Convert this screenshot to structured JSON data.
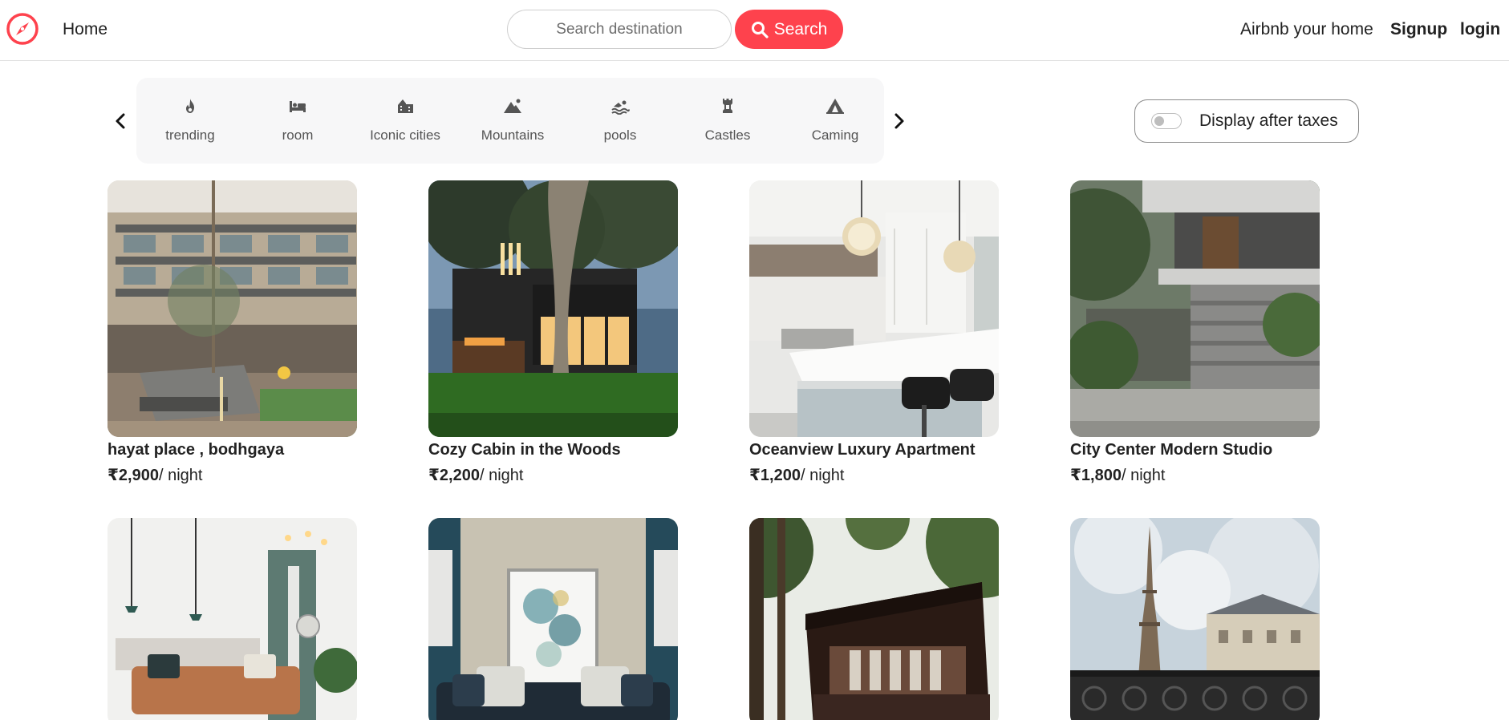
{
  "nav": {
    "logo_icon": "compass-icon",
    "home": "Home",
    "search_placeholder": "Search destination",
    "search_button": "Search",
    "airbnb_home": "Airbnb your home",
    "signup": "Signup",
    "login": "login"
  },
  "filters": [
    {
      "label": "trending",
      "icon": "fire-icon"
    },
    {
      "label": "room",
      "icon": "bed-icon"
    },
    {
      "label": "Iconic cities",
      "icon": "city-icon"
    },
    {
      "label": "Mountains",
      "icon": "mountain-icon"
    },
    {
      "label": "pools",
      "icon": "person-swimming-icon"
    },
    {
      "label": "Castles",
      "icon": "chess-rook-icon"
    },
    {
      "label": "Caming",
      "icon": "campground-icon"
    }
  ],
  "tax_toggle": {
    "label": "Display after taxes",
    "enabled": false
  },
  "listings": [
    {
      "title": "hayat place , bodhgaya",
      "price": "₹2,900",
      "per": "/ night"
    },
    {
      "title": "Cozy Cabin in the Woods",
      "price": "₹2,200",
      "per": "/ night"
    },
    {
      "title": "Oceanview Luxury Apartment",
      "price": "₹1,200",
      "per": "/ night"
    },
    {
      "title": "City Center Modern Studio",
      "price": "₹1,800",
      "per": "/ night"
    },
    {
      "title": "",
      "price": "",
      "per": ""
    },
    {
      "title": "",
      "price": "",
      "per": ""
    },
    {
      "title": "",
      "price": "",
      "per": ""
    },
    {
      "title": "",
      "price": "",
      "per": ""
    }
  ],
  "colors": {
    "accent": "#fe424d",
    "text": "#222222",
    "muted": "#555555"
  }
}
